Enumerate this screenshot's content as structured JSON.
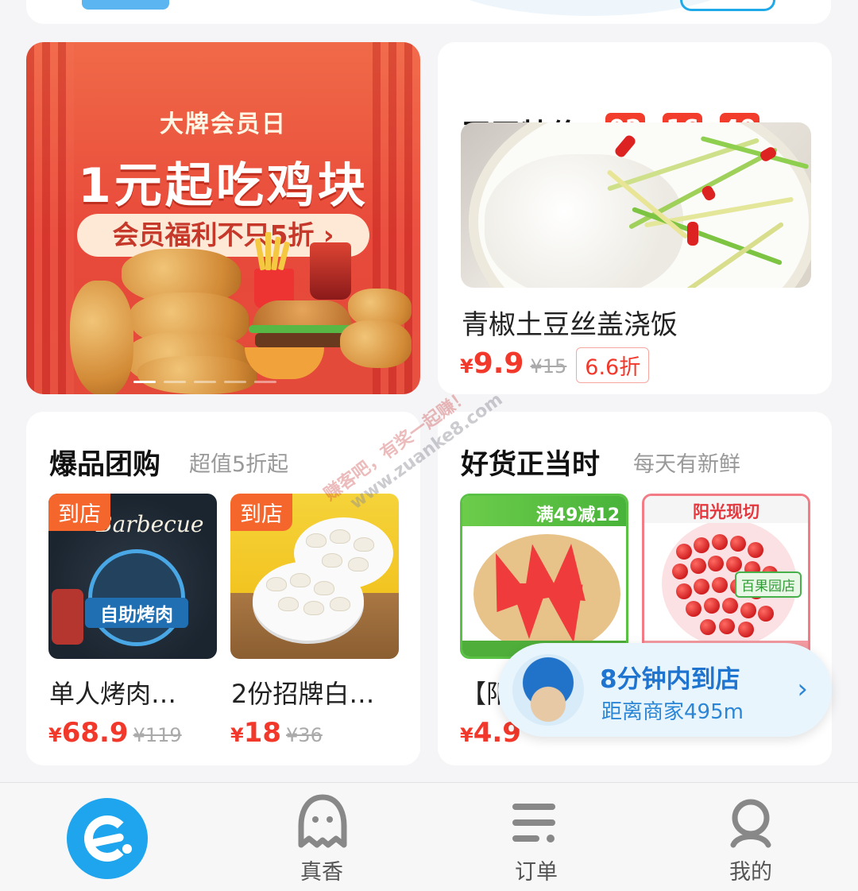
{
  "banner": {
    "tag": "大牌会员日",
    "title": "1元起吃鸡块",
    "pill": "会员福利不只5折 ›"
  },
  "deal": {
    "title": "天天特价",
    "timer": {
      "hours": "02",
      "minutes": "16",
      "seconds": "40"
    },
    "item_name": "青椒土豆丝盖浇饭",
    "currency": "¥",
    "price": "9.9",
    "original_price": "¥15",
    "discount": "6.6折"
  },
  "group_buy": {
    "title": "爆品团购",
    "subtitle": "超值5折起",
    "items": [
      {
        "badge": "到店",
        "image_text": "自助烤肉",
        "image_script": "Barbecue",
        "name": "单人烤肉…",
        "currency": "¥",
        "price": "68.9",
        "original_price": "¥119"
      },
      {
        "badge": "到店",
        "name": "2份招牌白…",
        "currency": "¥",
        "price": "18",
        "original_price": "¥36"
      }
    ]
  },
  "fresh": {
    "title": "好货正当时",
    "subtitle": "每天有新鲜",
    "items": [
      {
        "promo": "满49减12",
        "name": "【阳",
        "currency": "¥",
        "price": "4.9"
      },
      {
        "promo": "阳光现切",
        "tag": "百果园店"
      }
    ]
  },
  "delivery_popup": {
    "title": "8分钟内到店",
    "subtitle": "距离商家495m"
  },
  "tabbar": {
    "items": [
      {
        "label": "",
        "icon": "home-e-icon"
      },
      {
        "label": "真香",
        "icon": "ghost-icon"
      },
      {
        "label": "订单",
        "icon": "orders-icon"
      },
      {
        "label": "我的",
        "icon": "profile-icon"
      }
    ]
  },
  "watermark": {
    "line1": "赚客吧，有奖一起赚！",
    "line2": "www.zuanke8.com"
  },
  "colors": {
    "accent_red": "#f2382a",
    "brand_blue": "#1ea5ee",
    "badge_orange": "#f5662d"
  }
}
